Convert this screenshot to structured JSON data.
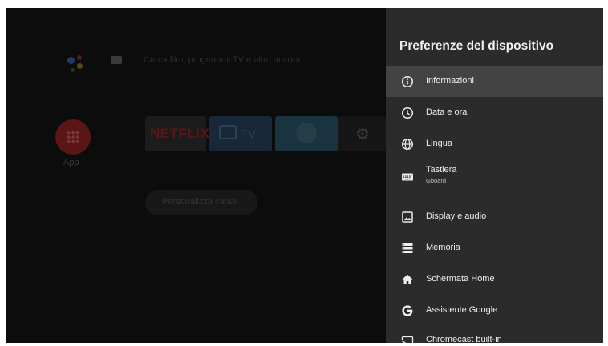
{
  "home": {
    "search_placeholder": "Cerca film, programmi TV e altro ancora",
    "app_label": "App",
    "netflix_label": "NETFLIX",
    "tv_label": "TV",
    "personalize_label": "Personalizza canali"
  },
  "panel": {
    "title": "Preferenze del dispositivo",
    "items": [
      {
        "label": "Informazioni",
        "icon": "info-icon",
        "selected": true
      },
      {
        "label": "Data e ora",
        "icon": "clock-icon"
      },
      {
        "label": "Lingua",
        "icon": "globe-icon"
      },
      {
        "label": "Tastiera",
        "sublabel": "Gboard",
        "icon": "keyboard-icon"
      },
      {
        "label": "Display e audio",
        "icon": "image-icon"
      },
      {
        "label": "Memoria",
        "icon": "storage-icon"
      },
      {
        "label": "Schermata Home",
        "icon": "home-icon"
      },
      {
        "label": "Assistente Google",
        "icon": "google-icon"
      },
      {
        "label": "Chromecast built-in",
        "icon": "cast-icon"
      }
    ]
  },
  "colors": {
    "panel_bg": "#2b2b2b",
    "selected_bg": "#434343",
    "text": "#eeeeee"
  }
}
